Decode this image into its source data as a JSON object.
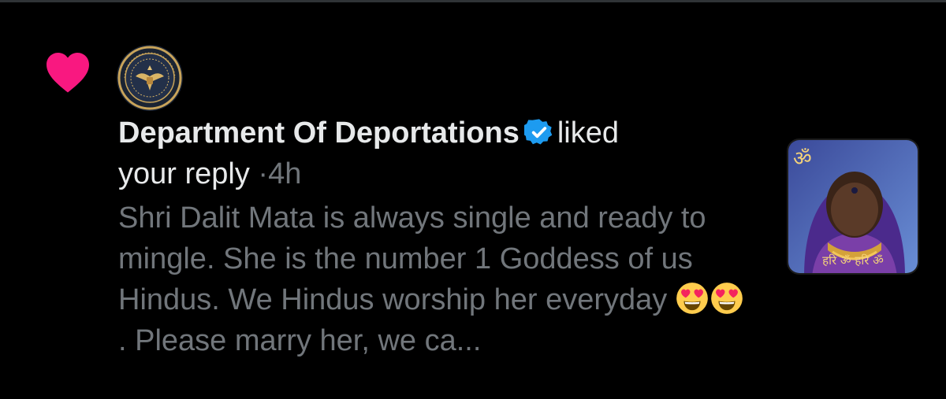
{
  "notification": {
    "type": "like",
    "author_name": "Department Of Deportations",
    "verified": true,
    "action_text": "liked",
    "action_object": "your reply",
    "separator": "·",
    "timestamp": "4h",
    "reply_text_parts": [
      "Shri Dalit Mata is always single and ready to mingle. She is the number 1 Goddess of us Hindus. We Hindus worship her everyday ",
      ". Please marry her, we ca..."
    ],
    "emoji": [
      "heart-eyes-emoji",
      "heart-eyes-emoji"
    ],
    "thumbnail": {
      "caption": "हरि ॐ हरि ॐ",
      "corner_symbol": "ॐ"
    }
  },
  "colors": {
    "background": "#000000",
    "heart": "#f91880",
    "primary_text": "#e7e9ea",
    "secondary_text": "#71767b",
    "verified": "#1d9bf0"
  },
  "icons": {
    "like": "heart-icon",
    "verified": "verified-badge-icon",
    "avatar": "department-seal-avatar"
  }
}
